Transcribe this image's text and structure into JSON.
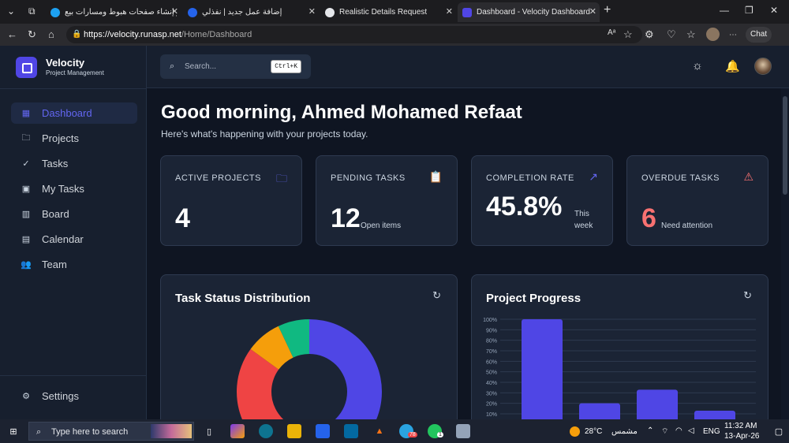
{
  "browser": {
    "tabs": [
      {
        "title": "خبير إنشاء صفحات هبوط ومسارات بيع"
      },
      {
        "title": "إضافة عمل جديد | نفذلي"
      },
      {
        "title": "Realistic Details Request"
      },
      {
        "title": "Dashboard - Velocity Dashboard"
      }
    ],
    "url_host": "https://velocity.runasp.net",
    "url_path": "/Home/Dashboard",
    "chat_label": "Chat"
  },
  "sidebar": {
    "brand": "Velocity",
    "brand_sub": "Project Management",
    "items": [
      {
        "label": "Dashboard",
        "icon": "grid-icon"
      },
      {
        "label": "Projects",
        "icon": "folder-icon"
      },
      {
        "label": "Tasks",
        "icon": "check-circle-icon"
      },
      {
        "label": "My Tasks",
        "icon": "user-square-icon"
      },
      {
        "label": "Board",
        "icon": "kanban-icon"
      },
      {
        "label": "Calendar",
        "icon": "calendar-icon"
      },
      {
        "label": "Team",
        "icon": "users-icon"
      }
    ],
    "settings_label": "Settings"
  },
  "header": {
    "search_placeholder": "Search...",
    "search_shortcut": "Ctrl+K"
  },
  "main": {
    "greeting": "Good morning, Ahmed Mohamed Refaat",
    "subtitle": "Here's what's happening with your projects today.",
    "stats": [
      {
        "title": "ACTIVE PROJECTS",
        "value": "4",
        "suffix": "",
        "icon": "folder-icon",
        "color": "#6366f1"
      },
      {
        "title": "PENDING TASKS",
        "value": "12",
        "suffix": "Open items",
        "icon": "clipboard-icon",
        "color": "#6366f1"
      },
      {
        "title": "COMPLETION RATE",
        "value": "45.8%",
        "suffix": "This week",
        "icon": "trending-up-icon",
        "color": "#6366f1"
      },
      {
        "title": "OVERDUE TASKS",
        "value": "6",
        "suffix": "Need attention",
        "icon": "alert-triangle-icon",
        "color": "#f87171"
      }
    ],
    "panels": {
      "task_status_title": "Task Status Distribution",
      "project_progress_title": "Project Progress"
    }
  },
  "chart_data": [
    {
      "type": "pie",
      "title": "Task Status Distribution",
      "slices": [
        {
          "value": 50,
          "color": "#4f46e5"
        },
        {
          "value": 35,
          "color": "#ef4444"
        },
        {
          "value": 8,
          "color": "#f59e0b"
        },
        {
          "value": 7,
          "color": "#10b981"
        }
      ]
    },
    {
      "type": "bar",
      "title": "Project Progress",
      "ylim": [
        0,
        100
      ],
      "yticks": [
        "100%",
        "90%",
        "80%",
        "70%",
        "60%",
        "50%",
        "40%",
        "30%",
        "20%",
        "10%"
      ],
      "values": [
        100,
        20,
        33,
        13
      ],
      "color": "#4f46e5"
    }
  ],
  "taskbar": {
    "search_placeholder": "Type here to search",
    "weather": "28°C",
    "weather_label": "مشمس",
    "lang": "ENG",
    "time": "11:32 AM",
    "date": "13-Apr-26",
    "telegram_badge": "78",
    "whatsapp_badge": "1"
  }
}
